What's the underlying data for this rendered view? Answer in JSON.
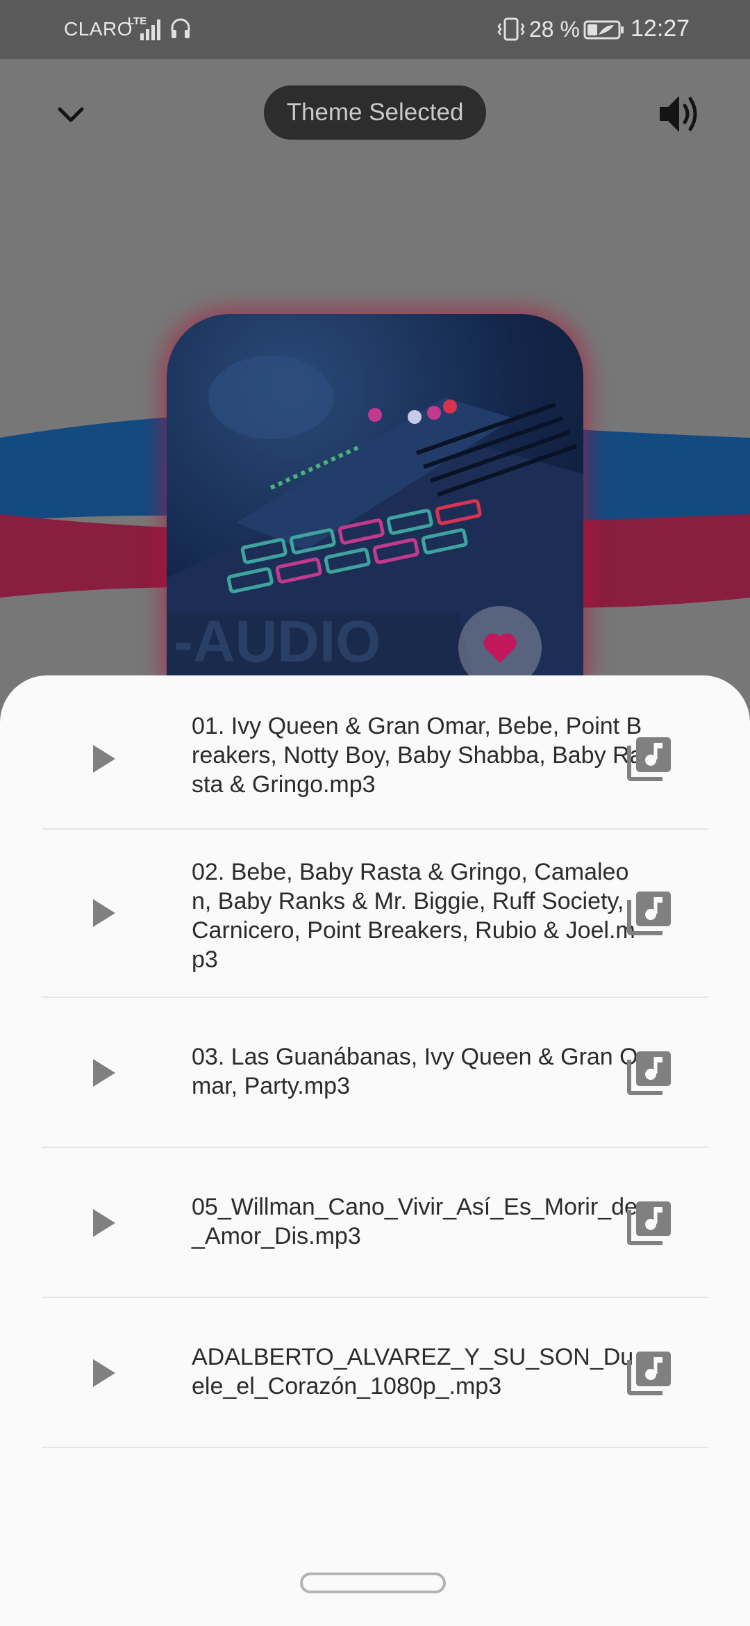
{
  "status_bar": {
    "carrier": "CLARO",
    "network": "LTE",
    "battery_percent": "28 %",
    "time": "12:27",
    "icons": [
      "signal-icon",
      "headset-icon",
      "vibrate-icon",
      "battery-icon"
    ]
  },
  "player": {
    "toast": "Theme Selected",
    "icons": [
      "chevron-down-icon",
      "volume-icon",
      "heart-icon"
    ],
    "colors": {
      "accent": "#c2185b",
      "wave_blue": "#134a80",
      "wave_red": "#8a1e40",
      "dim_background": "#777777"
    }
  },
  "tracks": [
    {
      "title": "01. Ivy Queen & Gran Omar, Bebe, Point Breakers, Notty Boy, Baby Shabba, Baby Rasta & Gringo.mp3"
    },
    {
      "title": "02. Bebe, Baby Rasta & Gringo, Camaleon, Baby Ranks & Mr. Biggie, Ruff Society, Carnicero, Point Breakers, Rubio & Joel.mp3"
    },
    {
      "title": "03. Las Guanábanas, Ivy Queen & Gran Omar, Party.mp3"
    },
    {
      "title": "05_Willman_Cano_Vivir_Así_Es_Morir_de_Amor_Dis.mp3"
    },
    {
      "title": "ADALBERTO_ALVAREZ_Y_SU_SON_Duele_el_Corazón_1080p_.mp3"
    }
  ]
}
